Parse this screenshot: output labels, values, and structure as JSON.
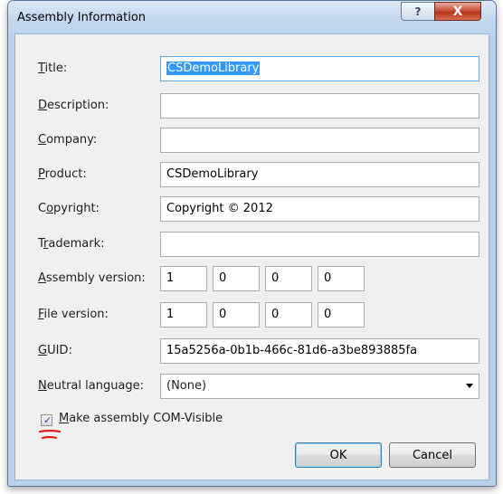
{
  "window": {
    "title": "Assembly Information"
  },
  "titlebar": {
    "help_glyph": "?",
    "close_glyph": "X"
  },
  "fields": {
    "title": {
      "label_pre": "",
      "label_acc": "T",
      "label_post": "itle:",
      "value": "CSDemoLibrary"
    },
    "description": {
      "label_pre": "",
      "label_acc": "D",
      "label_post": "escription:",
      "value": ""
    },
    "company": {
      "label_pre": "",
      "label_acc": "C",
      "label_post": "ompany:",
      "value": ""
    },
    "product": {
      "label_pre": "",
      "label_acc": "P",
      "label_post": "roduct:",
      "value": "CSDemoLibrary"
    },
    "copyright": {
      "label_pre": "C",
      "label_acc": "o",
      "label_post": "pyright:",
      "value": "Copyright ©  2012"
    },
    "trademark": {
      "label_pre": "T",
      "label_acc": "r",
      "label_post": "ademark:",
      "value": ""
    },
    "assembly_version": {
      "label_pre": "",
      "label_acc": "A",
      "label_post": "ssembly version:",
      "values": [
        "1",
        "0",
        "0",
        "0"
      ]
    },
    "file_version": {
      "label_pre": "",
      "label_acc": "F",
      "label_post": "ile version:",
      "values": [
        "1",
        "0",
        "0",
        "0"
      ]
    },
    "guid": {
      "label_pre": "",
      "label_acc": "G",
      "label_post": "UID:",
      "value": "15a5256a-0b1b-466c-81d6-a3be893885fa"
    },
    "neutral_language": {
      "label_pre": "",
      "label_acc": "N",
      "label_post": "eutral language:",
      "value": "(None)"
    }
  },
  "com_visible": {
    "label_acc": "M",
    "label_post": "ake assembly COM-Visible",
    "checked": true,
    "check_glyph": "✓"
  },
  "buttons": {
    "ok": "OK",
    "cancel": "Cancel"
  },
  "colors": {
    "selection": "#3399ff",
    "annotation": "#e8201a",
    "close_button": "#c8553d"
  }
}
